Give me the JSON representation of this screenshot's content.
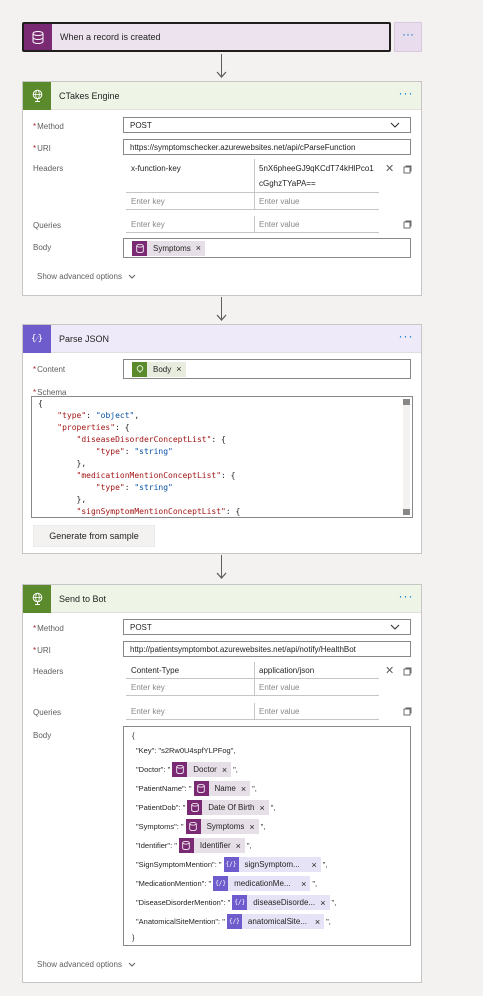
{
  "trigger": {
    "title": "When a record is created",
    "more": "···"
  },
  "ctakes": {
    "title": "CTakes Engine",
    "more": "···",
    "method_label": "Method",
    "method_value": "POST",
    "uri_label": "URI",
    "uri_value": "https://symptomschecker.azurewebsites.net/api/cParseFunction",
    "headers_label": "Headers",
    "header_key": "x-function-key",
    "header_value_line1": "5nX6pheeGJ9qKCdT74kHlPco1",
    "header_value_line2": "cGghzTYaPA==",
    "key_placeholder": "Enter key",
    "value_placeholder": "Enter value",
    "queries_label": "Queries",
    "body_label": "Body",
    "body_token": "Symptoms",
    "advanced": "Show advanced options"
  },
  "parse": {
    "title": "Parse JSON",
    "more": "···",
    "content_label": "Content",
    "content_token": "Body",
    "schema_label": "Schema",
    "schema_lines": [
      "{",
      "    \"type\": \"object\",",
      "    \"properties\": {",
      "        \"diseaseDisorderConceptList\": {",
      "            \"type\": \"string\"",
      "        },",
      "        \"medicationMentionConceptList\": {",
      "            \"type\": \"string\"",
      "        },",
      "        \"signSymptomMentionConceptList\": {"
    ],
    "generate_button": "Generate from sample"
  },
  "send": {
    "title": "Send to Bot",
    "more": "···",
    "method_label": "Method",
    "method_value": "POST",
    "uri_label": "URI",
    "uri_value": "http://patientsymptombot.azurewebsites.net/api/notify/HealthBot",
    "headers_label": "Headers",
    "header_key": "Content-Type",
    "header_value": "application/json",
    "key_placeholder": "Enter key",
    "value_placeholder": "Enter value",
    "queries_label": "Queries",
    "body_label": "Body",
    "body_open": "{",
    "body_close": "}",
    "key_line": "\"Key\": \"s2Rw0U4spfYLPFog\",",
    "fields": [
      {
        "key": "\"Doctor\": \"",
        "token": "Doctor",
        "kind": "db"
      },
      {
        "key": "\"PatientName\": \"",
        "token": "Name",
        "kind": "db"
      },
      {
        "key": "\"PatientDob\": \"",
        "token": "Date Of Birth",
        "kind": "db"
      },
      {
        "key": "\"Symptoms\": \"",
        "token": "Symptoms",
        "kind": "db"
      },
      {
        "key": "\"Identifier\": \"",
        "token": "Identifier",
        "kind": "db"
      },
      {
        "key": "\"SignSymptomMention\": \"",
        "token": "signSymptom...",
        "kind": "json"
      },
      {
        "key": "\"MedicationMention\": \"",
        "token": "medicationMe...",
        "kind": "json"
      },
      {
        "key": "\"DiseaseDisorderMention\": \"",
        "token": "diseaseDisorde...",
        "kind": "json"
      },
      {
        "key": "\"AnatomicalSiteMention\": \"",
        "token": "anatomicalSite...",
        "kind": "json"
      }
    ],
    "field_suffix": "\",",
    "advanced": "Show advanced options"
  },
  "colors": {
    "database": "#7a2a73",
    "http": "#5a8a2b",
    "json": "#6f5ccc",
    "link": "#0078d4"
  }
}
